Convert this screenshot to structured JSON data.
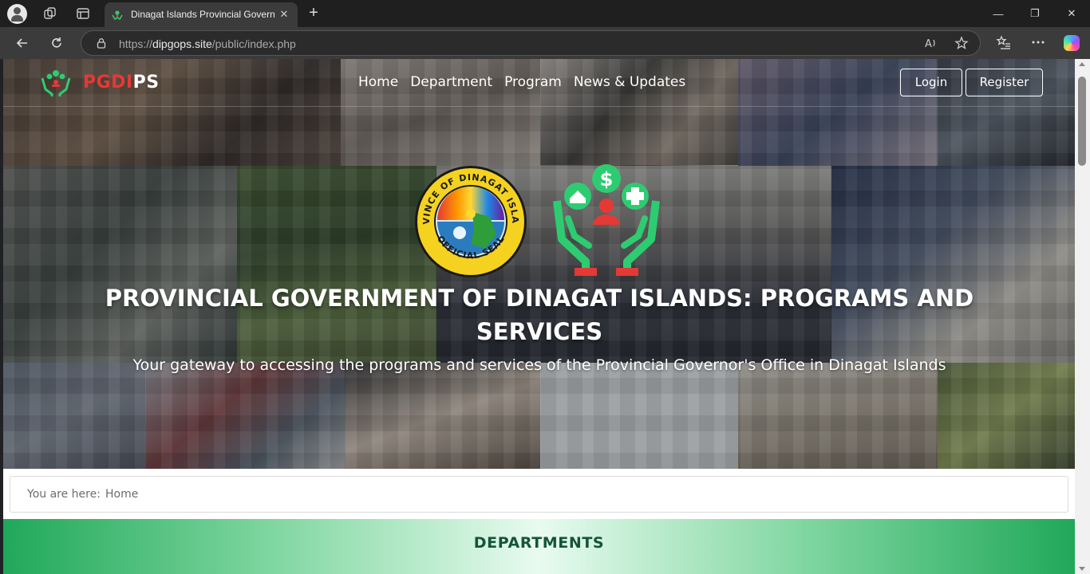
{
  "browser": {
    "tab_title": "Dinagat Islands Provincial Governo",
    "url_prefix": "https://",
    "url_domain": "dipgops.site",
    "url_path": "/public/index.php",
    "tab_close": "✕",
    "new_tab": "+",
    "win_minimize": "—",
    "win_maximize": "❐",
    "win_close": "✕"
  },
  "site": {
    "brand_part1": "PGDI",
    "brand_part2": "PS",
    "nav": [
      "Home",
      "Department",
      "Program",
      "News & Updates"
    ],
    "login_label": "Login",
    "register_label": "Register"
  },
  "hero": {
    "seal_top_text": "PROVINCE OF DINAGAT ISLANDS",
    "seal_bottom_text": "OFFICIAL SEAL",
    "title": "PROVINCIAL GOVERNMENT OF DINAGAT ISLANDS: PROGRAMS AND SERVICES",
    "subtitle": "Your gateway to accessing the programs and services of the Provincial Governor's Office in Dinagat Islands"
  },
  "breadcrumb": {
    "label": "You are here:",
    "current": "Home"
  },
  "departments": {
    "title": "DEPARTMENTS"
  },
  "colors": {
    "brand_red": "#e53935",
    "brand_green": "#20a85a",
    "dept_text": "#14543a"
  }
}
